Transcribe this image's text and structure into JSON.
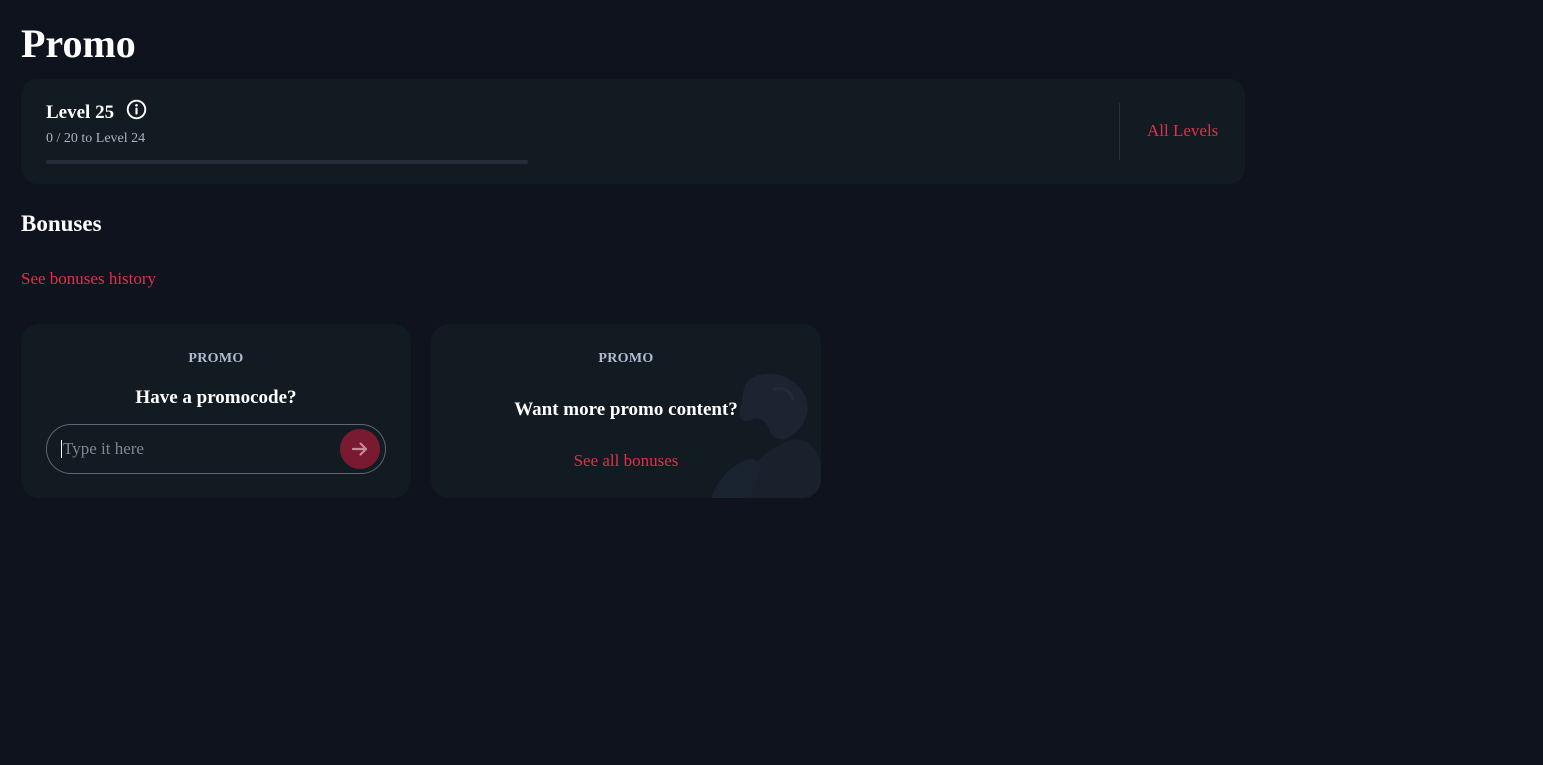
{
  "page": {
    "title": "Promo"
  },
  "level": {
    "title": "Level 25",
    "progress_text": "0 / 20 to Level 24",
    "progress_fraction": 0,
    "all_levels_label": "All Levels",
    "info_icon": "info-icon"
  },
  "bonuses": {
    "title": "Bonuses",
    "history_link": "See bonuses history",
    "cards": [
      {
        "label": "PROMO",
        "heading": "Have a promocode?",
        "input_placeholder": "Type it here",
        "input_value": "",
        "submit_icon": "arrow-right-icon"
      },
      {
        "label": "PROMO",
        "heading": "Want more promo content?",
        "link": "See all bonuses",
        "decoration_icon": "mask-icon"
      }
    ]
  },
  "colors": {
    "background": "#0e131d",
    "card": "#121a22",
    "accent": "#e0304a",
    "muted_text": "#a9b4c2"
  }
}
